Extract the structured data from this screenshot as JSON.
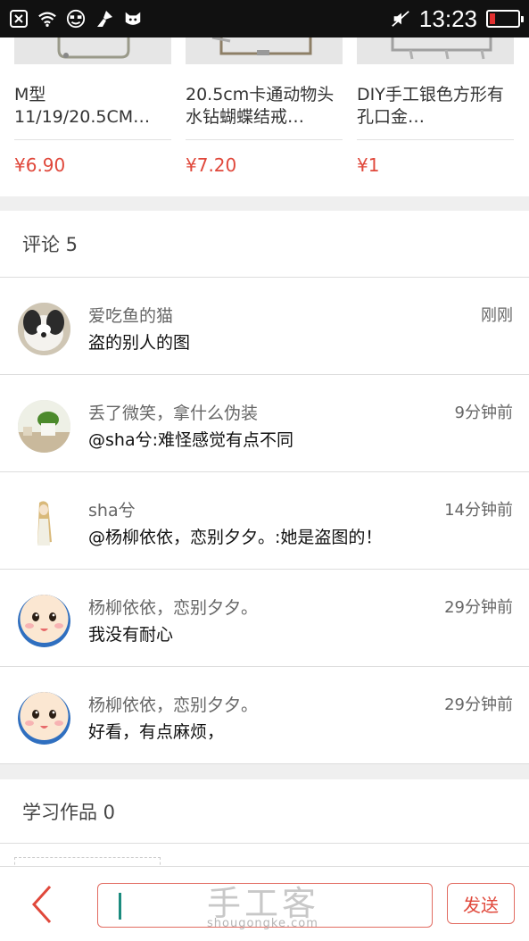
{
  "status_bar": {
    "time": "13:23"
  },
  "products": [
    {
      "title": "M型11/19/20.5CM…",
      "price": "¥6.90"
    },
    {
      "title": "20.5cm卡通动物头水钻蝴蝶结戒…",
      "price": "¥7.20"
    },
    {
      "title": "DIY手工银色方形有孔口金…",
      "price": "¥1"
    }
  ],
  "comments_section": {
    "title": "评论 5",
    "items": [
      {
        "user": "爱吃鱼的猫",
        "time": "刚刚",
        "text": "盗的别人的图",
        "avatar": "dog-photo"
      },
      {
        "user": "丢了微笑，拿什么伪装",
        "time": "9分钟前",
        "text": "@sha兮:难怪感觉有点不同",
        "avatar": "plant-photo"
      },
      {
        "user": "sha兮",
        "time": "14分钟前",
        "text": "@杨柳依依，恋别夕夕。:她是盗图的！",
        "avatar": "anime-girl-illustration"
      },
      {
        "user": "杨柳依依，恋别夕夕。",
        "time": "29分钟前",
        "text": "我没有耐心",
        "avatar": "cartoon-face"
      },
      {
        "user": "杨柳依依，恋别夕夕。",
        "time": "29分钟前",
        "text": "好看，有点麻烦，",
        "avatar": "cartoon-face"
      }
    ]
  },
  "works_section": {
    "title": "学习作品 0"
  },
  "bottom_bar": {
    "send_label": "发送",
    "input_value": ""
  },
  "watermark": {
    "text": "手工客",
    "url": "shougongke.com"
  },
  "colors": {
    "accent": "#e0483b",
    "status_bar": "#111111",
    "caret": "#1b8b7e"
  }
}
